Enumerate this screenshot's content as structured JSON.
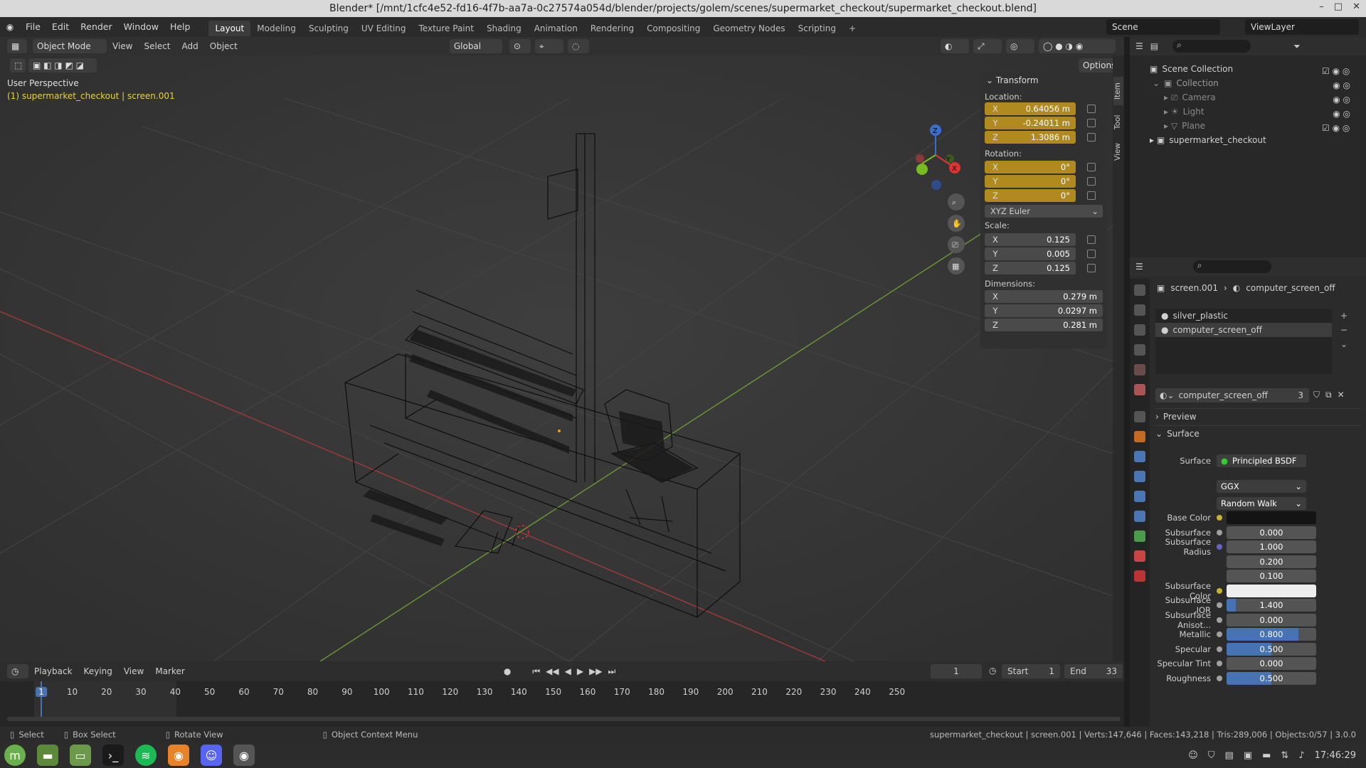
{
  "window": {
    "title": "Blender* [/mnt/1cfc4e52-fd16-4f7b-aa7a-0c27574a054d/blender/projects/golem/scenes/supermarket_checkout/supermarket_checkout.blend]"
  },
  "menu": [
    "File",
    "Edit",
    "Render",
    "Window",
    "Help"
  ],
  "workspaces": [
    "Layout",
    "Modeling",
    "Sculpting",
    "UV Editing",
    "Texture Paint",
    "Shading",
    "Animation",
    "Rendering",
    "Compositing",
    "Geometry Nodes",
    "Scripting"
  ],
  "active_workspace": "Layout",
  "scene_name": "Scene",
  "view_layer": "ViewLayer",
  "viewport_header": {
    "mode": "Object Mode",
    "view": "View",
    "select": "Select",
    "add": "Add",
    "object": "Object",
    "orientation": "Global",
    "options": "Options"
  },
  "viewport": {
    "perspective": "User Perspective",
    "object_info": "(1) supermarket_checkout | screen.001"
  },
  "npanel": {
    "title": "Transform",
    "location_label": "Location:",
    "location": [
      {
        "ax": "X",
        "val": "0.64056 m"
      },
      {
        "ax": "Y",
        "val": "-0.24011 m"
      },
      {
        "ax": "Z",
        "val": "1.3086 m"
      }
    ],
    "rotation_label": "Rotation:",
    "rotation": [
      {
        "ax": "X",
        "val": "0°"
      },
      {
        "ax": "Y",
        "val": "0°"
      },
      {
        "ax": "Z",
        "val": "0°"
      }
    ],
    "rotation_mode": "XYZ Euler",
    "scale_label": "Scale:",
    "scale": [
      {
        "ax": "X",
        "val": "0.125"
      },
      {
        "ax": "Y",
        "val": "0.005"
      },
      {
        "ax": "Z",
        "val": "0.125"
      }
    ],
    "dimensions_label": "Dimensions:",
    "dimensions": [
      {
        "ax": "X",
        "val": "0.279 m"
      },
      {
        "ax": "Y",
        "val": "0.0297 m"
      },
      {
        "ax": "Z",
        "val": "0.281 m"
      }
    ],
    "tabs": [
      "Item",
      "Tool",
      "View"
    ]
  },
  "outliner": {
    "scene_collection": "Scene Collection",
    "collection": "Collection",
    "items": [
      "Camera",
      "Light",
      "Plane"
    ],
    "supermarket": "supermarket_checkout"
  },
  "properties": {
    "breadcrumb_object": "screen.001",
    "breadcrumb_material": "computer_screen_off",
    "slots": [
      "silver_plastic",
      "computer_screen_off"
    ],
    "material_name": "computer_screen_off",
    "users": "3",
    "preview": "Preview",
    "surface_section": "Surface",
    "surface_label": "Surface",
    "surface_value": "Principled BSDF",
    "distribution": "GGX",
    "subsurface_method": "Random Walk",
    "rows": [
      {
        "label": "Base Color",
        "value": "",
        "dot": "#c8b22e",
        "color": "#141414"
      },
      {
        "label": "Subsurface",
        "value": "0.000",
        "dot": "#a0a0a0",
        "fill": 0
      },
      {
        "label": "Subsurface Radius",
        "value": "1.000",
        "dot": "#6363c7"
      },
      {
        "label": "",
        "value": "0.200"
      },
      {
        "label": "",
        "value": "0.100"
      },
      {
        "label": "Subsurface Color",
        "value": "",
        "dot": "#c8b22e",
        "color": "#eeeeee"
      },
      {
        "label": "Subsurface IOR",
        "value": "1.400",
        "dot": "#a0a0a0",
        "fill": 0.1
      },
      {
        "label": "Subsurface Anisot...",
        "value": "0.000",
        "dot": "#a0a0a0",
        "fill": 0
      },
      {
        "label": "Metallic",
        "value": "0.800",
        "dot": "#a0a0a0",
        "fill": 0.8
      },
      {
        "label": "Specular",
        "value": "0.500",
        "dot": "#a0a0a0",
        "fill": 0.5
      },
      {
        "label": "Specular Tint",
        "value": "0.000",
        "dot": "#a0a0a0",
        "fill": 0
      },
      {
        "label": "Roughness",
        "value": "0.500",
        "dot": "#a0a0a0",
        "fill": 0.5
      }
    ]
  },
  "timeline": {
    "playback": "Playback",
    "keying": "Keying",
    "view": "View",
    "marker": "Marker",
    "current_frame": "1",
    "start_label": "Start",
    "start": "1",
    "end_label": "End",
    "end": "33",
    "ticks": [
      "1",
      "10",
      "20",
      "30",
      "40",
      "50",
      "60",
      "70",
      "80",
      "90",
      "100",
      "110",
      "120",
      "130",
      "140",
      "150",
      "160",
      "170",
      "180",
      "190",
      "200",
      "210",
      "220",
      "230",
      "240",
      "250"
    ]
  },
  "statusbar": {
    "select": "Select",
    "box_select": "Box Select",
    "rotate_view": "Rotate View",
    "context_menu": "Object Context Menu",
    "stats": "supermarket_checkout | screen.001 | Verts:147,646 | Faces:143,218 | Tris:289,006 | Objects:0/57 | 3.0.0"
  },
  "taskbar": {
    "time": "17:46:29"
  }
}
